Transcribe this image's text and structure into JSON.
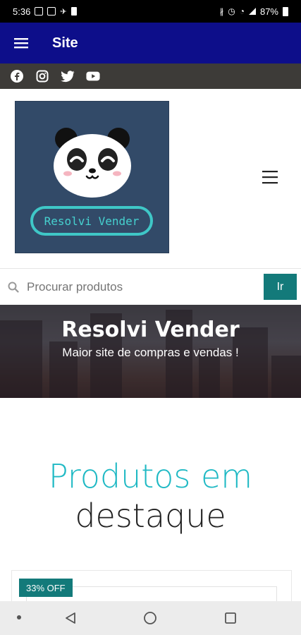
{
  "status_bar": {
    "time": "5:36",
    "battery": "87%"
  },
  "appbar": {
    "title": "Site",
    "icons": [
      "menu-icon"
    ]
  },
  "social": {
    "icons": [
      "facebook-icon",
      "instagram-icon",
      "twitter-icon",
      "youtube-icon"
    ]
  },
  "logo": {
    "button_label": "Resolvi Vender"
  },
  "search": {
    "placeholder": "Procurar produtos",
    "button_label": "Ir"
  },
  "hero": {
    "title": "Resolvi Vender",
    "subtitle": "Maior site de compras e vendas !"
  },
  "featured": {
    "title_line1": "Produtos em",
    "title_line2": "destaque",
    "badge": "33% OFF"
  },
  "colors": {
    "appbar": "#0d0e8a",
    "social_bar": "#3d3b38",
    "accent_teal": "#137a7a",
    "title_cyan": "#1fb9c4",
    "logo_bg": "#324a68"
  }
}
